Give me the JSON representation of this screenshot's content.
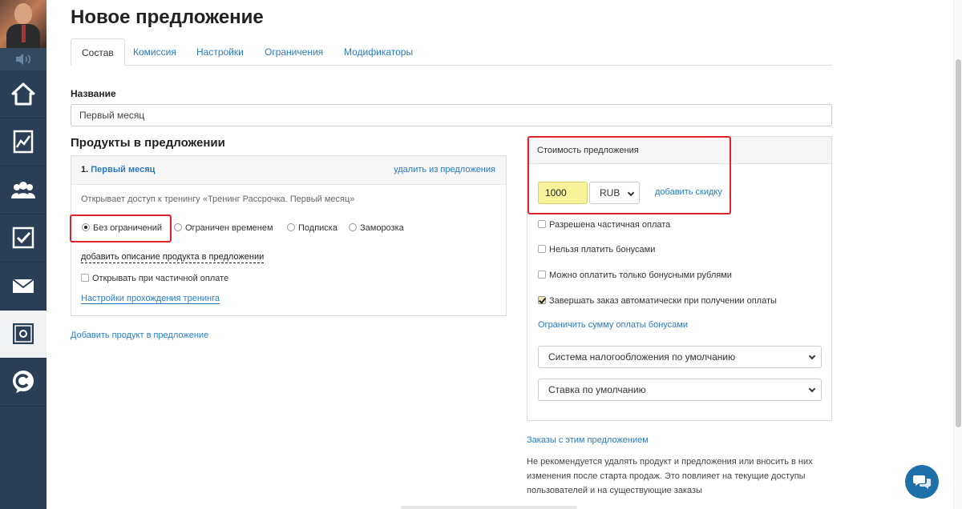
{
  "page": {
    "title": "Новое предложение"
  },
  "tabs": [
    {
      "label": "Состав",
      "active": true
    },
    {
      "label": "Комиссия",
      "active": false
    },
    {
      "label": "Настройки",
      "active": false
    },
    {
      "label": "Ограничения",
      "active": false
    },
    {
      "label": "Модификаторы",
      "active": false
    }
  ],
  "name_field": {
    "label": "Название",
    "value": "Первый месяц"
  },
  "products": {
    "heading": "Продукты в предложении",
    "item": {
      "number": "1.",
      "name": "Первый месяц",
      "remove_label": "удалить из предложения",
      "description": "Открывает доступ к тренингу «Тренинг Рассрочка. Первый месяц»",
      "access_options": [
        {
          "label": "Без ограничений",
          "selected": true
        },
        {
          "label": "Ограничен временем",
          "selected": false
        },
        {
          "label": "Подписка",
          "selected": false
        },
        {
          "label": "Заморозка",
          "selected": false
        }
      ],
      "add_description_label": "добавить описание продукта в предложении",
      "partial_payment_label": "Открывать при частичной оплате",
      "partial_payment_checked": false,
      "training_settings_label": "Настройки прохождения тренинга"
    },
    "add_product_label": "Добавить продукт в предложение"
  },
  "price": {
    "heading": "Стоимость предложения",
    "amount": "1000",
    "currency": "RUB",
    "add_discount_label": "добавить скидку",
    "options": [
      {
        "label": "Разрешена частичная оплата",
        "checked": false
      },
      {
        "label": "Нельзя платить бонусами",
        "checked": false
      },
      {
        "label": "Можно оплатить только бонусными рублями",
        "checked": false
      },
      {
        "label": "Завершать заказ автоматически при получении оплаты",
        "checked": true
      }
    ],
    "limit_bonus_label": "Ограничить сумму оплаты бонусами",
    "tax_system": "Система налогообложения по умолчанию",
    "tax_rate": "Ставка по умолчанию"
  },
  "orders_link": "Заказы с этим предложением",
  "warning": "Не рекомендуется удалять продукт и предложения или вносить в них изменения после старта продаж. Это повлияет на текущие доступы пользователей и на существующие заказы",
  "sidebar": {
    "items": [
      {
        "icon": "home-icon"
      },
      {
        "icon": "chart-icon"
      },
      {
        "icon": "users-icon"
      },
      {
        "icon": "tasks-icon"
      },
      {
        "icon": "mail-icon"
      },
      {
        "icon": "safe-icon",
        "active": true
      },
      {
        "icon": "chat-logo-icon"
      }
    ]
  },
  "colors": {
    "sidebar": "#2a3f55",
    "link": "#2b7bc0",
    "highlight": "#e0242b",
    "price_input": "#f7f39a"
  }
}
